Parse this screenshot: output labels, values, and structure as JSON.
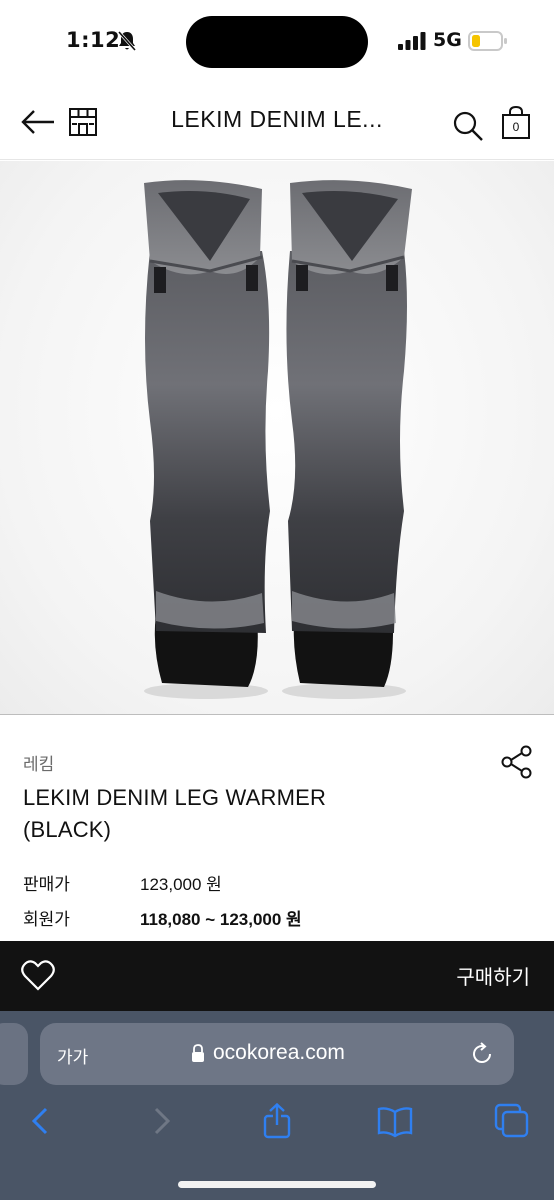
{
  "status_bar": {
    "time": "1:12",
    "network": "5G",
    "icons": [
      "bell-slash-icon",
      "signal-icon",
      "battery-icon"
    ],
    "battery_color": "#f5c400"
  },
  "header": {
    "title": "LEKIM DENIM LE...",
    "cart_count": "0",
    "icons": [
      "back-arrow-icon",
      "store-icon",
      "search-icon",
      "shopping-bag-icon"
    ]
  },
  "product": {
    "brand": "레킴",
    "name_line1": "LEKIM DENIM LEG WARMER",
    "name_line2": "(BLACK)",
    "image_description_icon": "product-photo",
    "prices": [
      {
        "label": "판매가",
        "value": "123,000 원"
      },
      {
        "label": "회원가",
        "value": "118,080 ~ 123,000 원"
      }
    ]
  },
  "purchase_bar": {
    "buy_label": "구매하기",
    "wish_icon": "heart-outline-icon",
    "background": "#121212"
  },
  "browser": {
    "text_size_label": "가가",
    "url": "ocokorea.com",
    "toolbar_icons": [
      "back-chevron-icon",
      "forward-chevron-icon",
      "share-icon",
      "bookmarks-icon",
      "tabs-icon"
    ],
    "accent": "#2f7ff0"
  }
}
